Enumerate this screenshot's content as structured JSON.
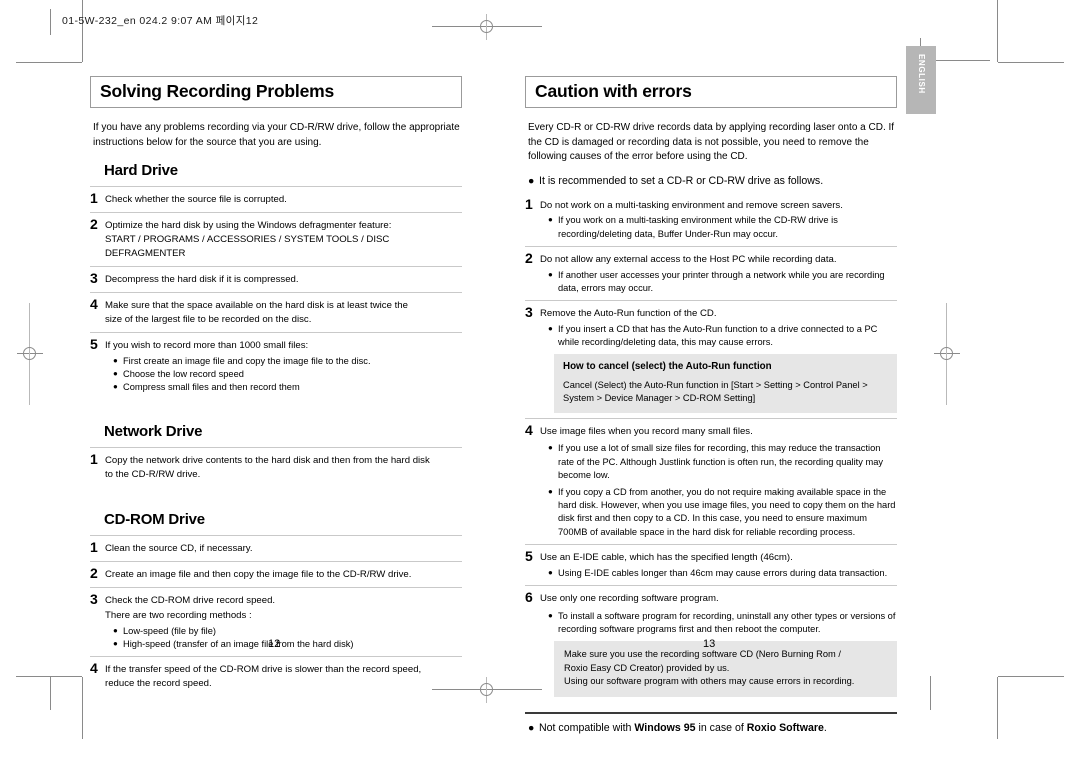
{
  "slug": "01-5W-232_en  024.2 9:07 AM  페이지12",
  "side_tab": "ENGLISH",
  "page_numbers": {
    "left": "12",
    "right": "13"
  },
  "left_page": {
    "title": "Solving Recording Problems",
    "intro_line1": "If you have any problems recording via your CD-R/RW drive,",
    "intro_line2": "follow the appropriate instructions below for the source that you are using.",
    "sections": [
      {
        "heading": "Hard Drive",
        "items": [
          {
            "num": "1",
            "lines": [
              "Check whether the source file is corrupted."
            ]
          },
          {
            "num": "2",
            "lines": [
              "Optimize the hard disk by using the Windows defragmenter feature:",
              "START / PROGRAMS / ACCESSORIES / SYSTEM TOOLS / DISC DEFRAGMENTER"
            ]
          },
          {
            "num": "3",
            "lines": [
              "Decompress the hard disk if it is compressed."
            ]
          },
          {
            "num": "4",
            "lines": [
              "Make sure that the space available on the hard disk is at least twice the",
              "size of the largest file to be recorded on the disc."
            ]
          },
          {
            "num": "5",
            "lines": [
              "If you wish to record more than 1000 small files:"
            ],
            "bullets": [
              "First create an image file and copy the image file to the disc.",
              "Choose the low record speed",
              "Compress small files and then record them"
            ]
          }
        ]
      },
      {
        "heading": "Network Drive",
        "items": [
          {
            "num": "1",
            "lines": [
              "Copy the network drive contents to the hard disk and then from the hard disk",
              "to the CD-R/RW drive."
            ]
          }
        ]
      },
      {
        "heading": "CD-ROM Drive",
        "items": [
          {
            "num": "1",
            "lines": [
              "Clean the source CD, if necessary."
            ]
          },
          {
            "num": "2",
            "lines": [
              "Create an image file and then copy the image file to the CD-R/RW drive."
            ]
          },
          {
            "num": "3",
            "lines": [
              "Check the CD-ROM drive record speed."
            ],
            "plain": "There are two recording methods :",
            "bullets": [
              "Low-speed (file by file)",
              "High-speed (transfer of an image file from the hard disk)"
            ]
          },
          {
            "num": "4",
            "lines": [
              "If the transfer speed of the CD-ROM drive is slower than the record speed,",
              "reduce the record speed."
            ]
          }
        ]
      }
    ]
  },
  "right_page": {
    "title": "Caution with errors",
    "intro_line1": "Every CD-R or CD-RW drive records data by applying recording laser onto a CD.",
    "intro_line2": "If the CD is damaged or recording data is not possible, you need to remove the",
    "intro_line3": "following causes of the error before using the CD.",
    "lead_bullet": "It is recommended to set a CD-R or CD-RW drive as follows.",
    "items": [
      {
        "num": "1",
        "lines": [
          "Do not work on a multi-tasking environment and remove screen savers."
        ],
        "bullets": [
          "If you work on a multi-tasking environment while the CD-RW drive is recording/deleting data, Buffer Under-Run may occur."
        ]
      },
      {
        "num": "2",
        "lines": [
          "Do not allow any external access to the Host PC while recording data."
        ],
        "bullets": [
          "If another user accesses your printer through a network while you are recording data, errors may occur."
        ]
      },
      {
        "num": "3",
        "lines": [
          "Remove the Auto-Run function of the CD."
        ],
        "bullets": [
          "If you insert a CD that has the Auto-Run function to a drive connected to a PC while recording/deleting data, this may cause errors."
        ],
        "notebox": {
          "title": "How to cancel (select) the Auto-Run function",
          "lines": [
            "Cancel (Select) the Auto-Run function in [Start > Setting > Control Panel >",
            "System > Device Manager > CD-ROM Setting]"
          ]
        }
      },
      {
        "num": "4",
        "lines": [
          "Use image files when you record many small files."
        ],
        "bullets": [
          "If you use a lot of small size files for recording, this may reduce the transaction rate of the PC. Although Justlink function is often run, the recording quality may become low.",
          "If you copy a CD from another, you do not require making available space in the hard disk. However, when you use image files, you need to copy them on the hard disk first and then copy to a CD. In this case, you need to ensure maximum 700MB of available space in the hard disk for reliable recording process."
        ]
      },
      {
        "num": "5",
        "lines": [
          "Use an E-IDE cable, which has the specified length (46cm)."
        ],
        "bullets": [
          "Using E-IDE cables longer than 46cm may cause errors during data transaction."
        ]
      },
      {
        "num": "6",
        "lines": [
          "Use only one recording software program."
        ],
        "bullets": [
          "To install a software program for recording, uninstall any other types or versions of recording software programs first and then reboot the computer."
        ],
        "notebox_plain": {
          "lines": [
            "Make sure you use the recording software CD (Nero Burning Rom /",
            "Roxio Easy CD Creator) provided by us.",
            "Using our software program with others may cause errors in recording."
          ]
        }
      }
    ],
    "final_bullet": {
      "pre": "Not compatible with ",
      "bold1": "Windows 95",
      "mid": " in case of ",
      "bold2": "Roxio Software",
      "post": "."
    }
  }
}
